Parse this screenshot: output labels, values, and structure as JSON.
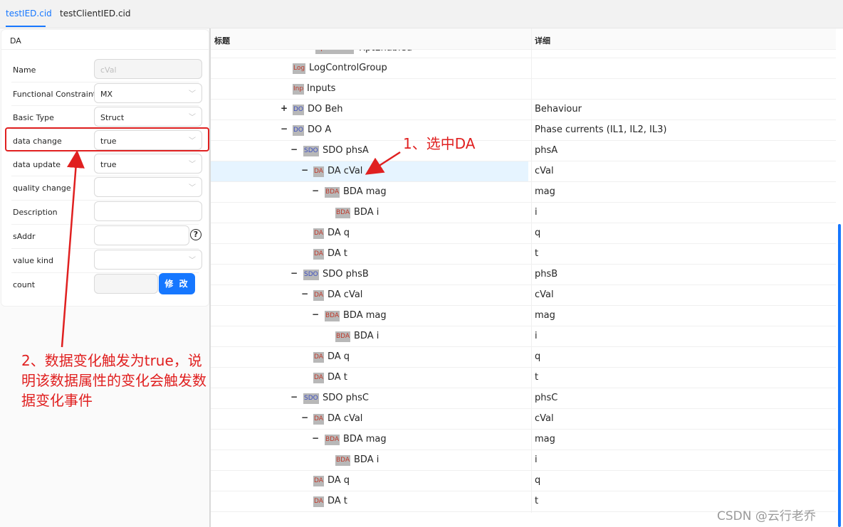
{
  "tabs": [
    {
      "label": "testIED.cid",
      "active": true
    },
    {
      "label": "testClientIED.cid",
      "active": false
    }
  ],
  "form": {
    "header": "DA",
    "fields": [
      {
        "label": "Name",
        "value": "cVal",
        "type": "input",
        "disabled": true
      },
      {
        "label": "Functional Constraint",
        "value": "MX",
        "type": "select"
      },
      {
        "label": "Basic Type",
        "value": "Struct",
        "type": "select"
      },
      {
        "label": "data change",
        "value": "true",
        "type": "select"
      },
      {
        "label": "data update",
        "value": "true",
        "type": "select"
      },
      {
        "label": "quality change",
        "value": "",
        "type": "select"
      },
      {
        "label": "Description",
        "value": "",
        "type": "input"
      },
      {
        "label": "sAddr",
        "value": "",
        "type": "input",
        "help": "?"
      },
      {
        "label": "value kind",
        "value": "",
        "type": "select"
      },
      {
        "label": "count",
        "value": "",
        "type": "input",
        "disabled": true
      }
    ],
    "modify_button": "修 改"
  },
  "table": {
    "columns": [
      "标题",
      "详细"
    ],
    "rows": [
      {
        "badge": "RptEnabled",
        "name": "RptEnabled",
        "detail": "",
        "expander": "",
        "partial": true
      },
      {
        "badge": "Log",
        "name": "LogControlGroup",
        "detail": "",
        "expander": ""
      },
      {
        "badge": "Inp",
        "name": "Inputs",
        "detail": "",
        "expander": ""
      },
      {
        "badge": "DO",
        "name": "DO Beh",
        "detail": "Behaviour",
        "expander": "+"
      },
      {
        "badge": "DO",
        "name": "DO A",
        "detail": "Phase currents (IL1, IL2, IL3)",
        "expander": "−"
      },
      {
        "badge": "SDO",
        "name": "SDO phsA",
        "detail": "phsA",
        "expander": "−"
      },
      {
        "badge": "DA",
        "name": "DA cVal",
        "detail": "cVal",
        "expander": "−",
        "selected": true
      },
      {
        "badge": "BDA",
        "name": "BDA mag",
        "detail": "mag",
        "expander": "−"
      },
      {
        "badge": "BDA",
        "name": "BDA i",
        "detail": "i",
        "expander": ""
      },
      {
        "badge": "DA",
        "name": "DA q",
        "detail": "q",
        "expander": ""
      },
      {
        "badge": "DA",
        "name": "DA t",
        "detail": "t",
        "expander": ""
      },
      {
        "badge": "SDO",
        "name": "SDO phsB",
        "detail": "phsB",
        "expander": "−"
      },
      {
        "badge": "DA",
        "name": "DA cVal",
        "detail": "cVal",
        "expander": "−"
      },
      {
        "badge": "BDA",
        "name": "BDA mag",
        "detail": "mag",
        "expander": "−"
      },
      {
        "badge": "BDA",
        "name": "BDA i",
        "detail": "i",
        "expander": ""
      },
      {
        "badge": "DA",
        "name": "DA q",
        "detail": "q",
        "expander": ""
      },
      {
        "badge": "DA",
        "name": "DA t",
        "detail": "t",
        "expander": ""
      },
      {
        "badge": "SDO",
        "name": "SDO phsC",
        "detail": "phsC",
        "expander": "−"
      },
      {
        "badge": "DA",
        "name": "DA cVal",
        "detail": "cVal",
        "expander": "−"
      },
      {
        "badge": "BDA",
        "name": "BDA mag",
        "detail": "mag",
        "expander": "−"
      },
      {
        "badge": "BDA",
        "name": "BDA i",
        "detail": "i",
        "expander": ""
      },
      {
        "badge": "DA",
        "name": "DA q",
        "detail": "q",
        "expander": ""
      },
      {
        "badge": "DA",
        "name": "DA t",
        "detail": "t",
        "expander": ""
      }
    ]
  },
  "annotations": {
    "step1": "1、选中DA",
    "step2": "2、数据变化触发为true，说明该数据属性的变化会触发数据变化事件",
    "color": "#e02020"
  },
  "watermark": "CSDN @云行老乔",
  "colors": {
    "accent": "#1677ff",
    "selected_row": "#e6f4ff"
  }
}
